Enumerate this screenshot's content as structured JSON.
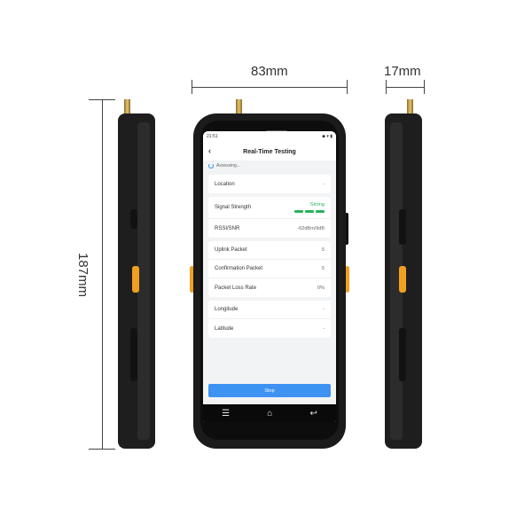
{
  "dimensions": {
    "width": "83mm",
    "depth": "17mm",
    "height": "187mm"
  },
  "status_bar": {
    "time": "21:51",
    "icons": "◆ ▾ ▮"
  },
  "app": {
    "title": "Real-Time Testing",
    "status": "Assessing...",
    "stop_label": "Stop"
  },
  "rows": {
    "location": {
      "label": "Location",
      "value": "-"
    },
    "signal": {
      "label": "Signal Strength",
      "value": "Strong",
      "level": 3,
      "max_level": 3
    },
    "rssi": {
      "label": "RSSI/SNR",
      "value": "-62dBm/9dB"
    },
    "uplink": {
      "label": "Uplink Packet",
      "value": "5"
    },
    "confirmation": {
      "label": "Confirmation Packet",
      "value": "5"
    },
    "loss": {
      "label": "Packet Loss Rate",
      "value": "0%"
    },
    "longitude": {
      "label": "Longitude",
      "value": "-"
    },
    "latitude": {
      "label": "Latitude",
      "value": "-"
    }
  },
  "nav": {
    "menu_icon": "☰",
    "home_icon": "⌂",
    "back_icon": "↩"
  },
  "colors": {
    "accent": "#3d92f2",
    "signal_green": "#2bb05a",
    "orange_key": "#f0a020"
  }
}
